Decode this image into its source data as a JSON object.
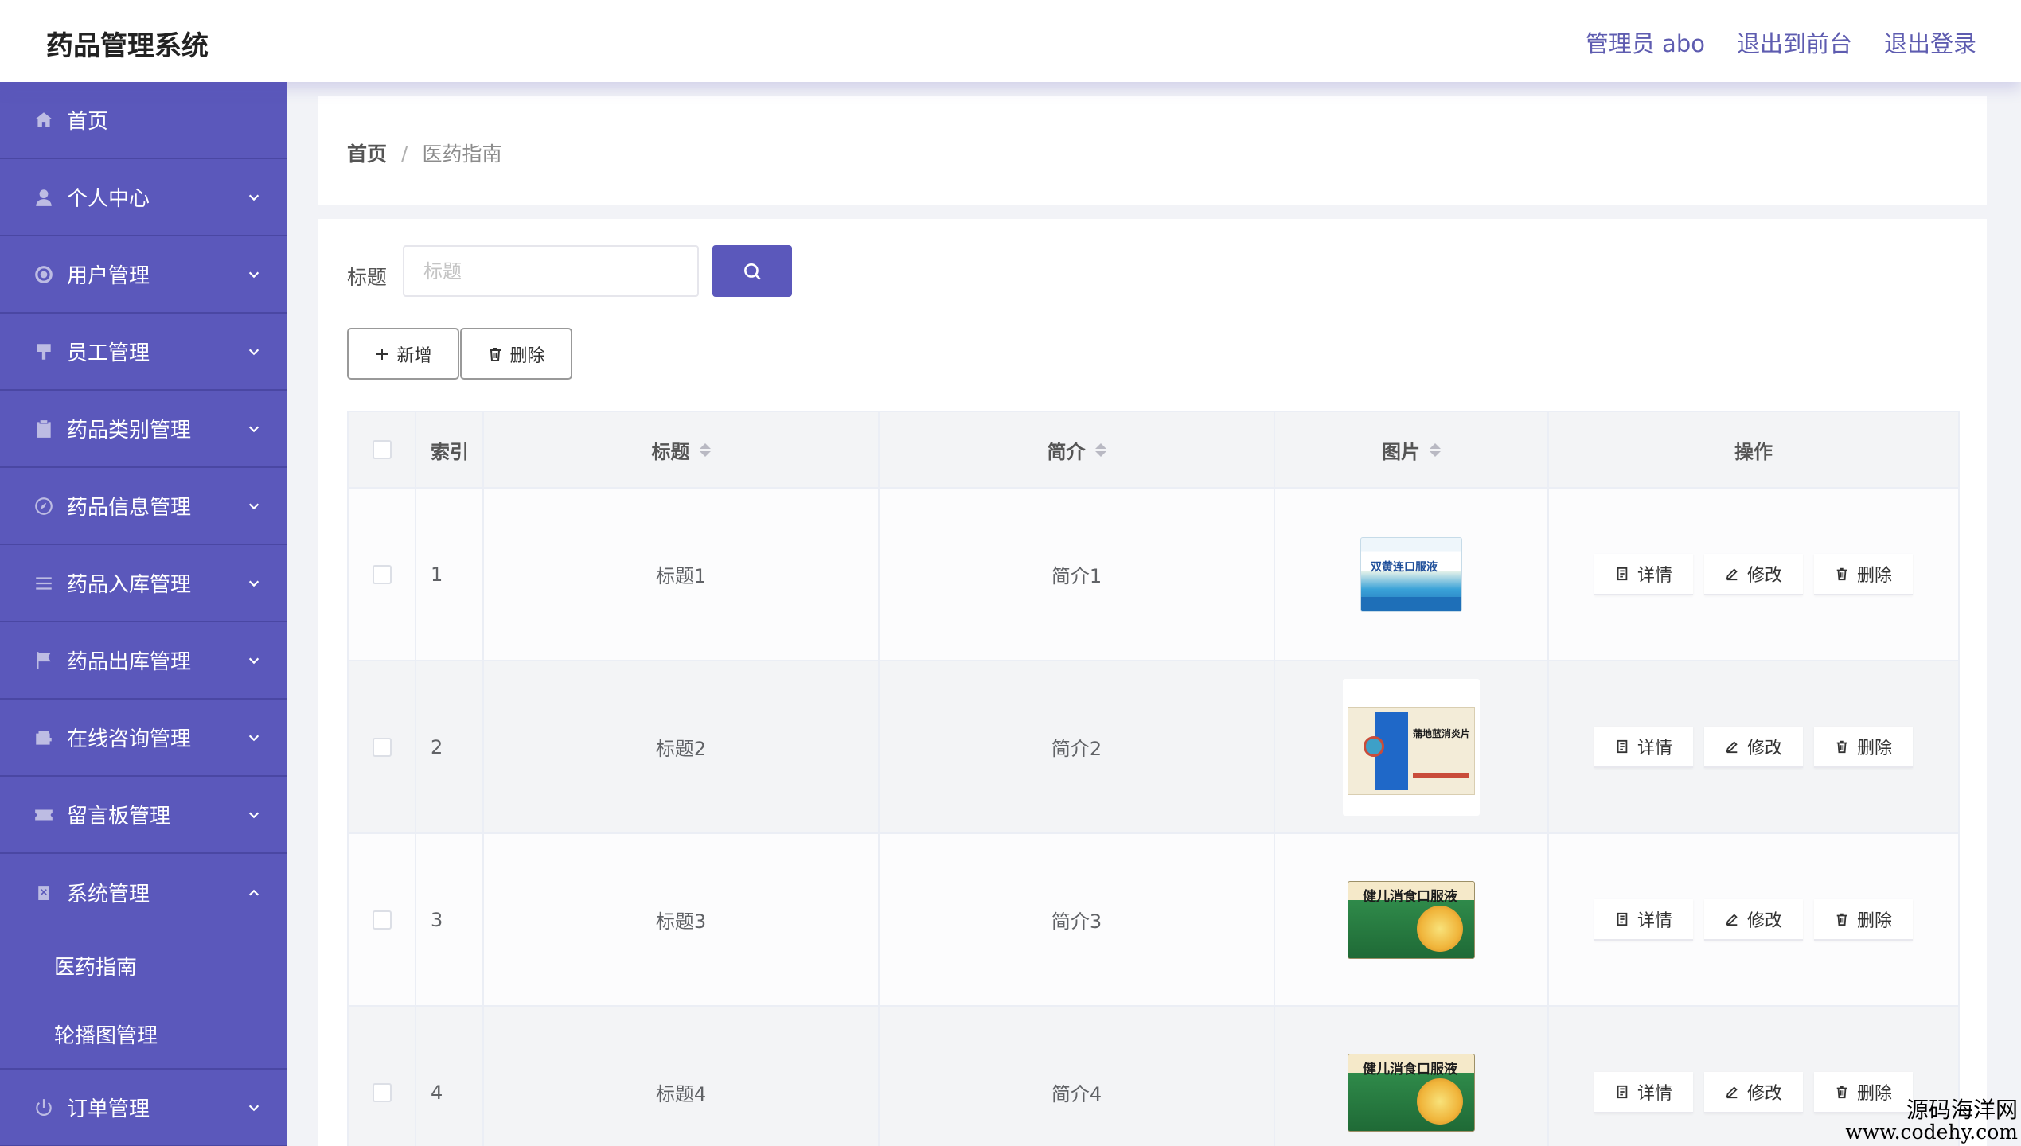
{
  "header": {
    "app_title": "药品管理系统",
    "user": "管理员 abo",
    "to_front": "退出到前台",
    "logout": "退出登录"
  },
  "sidebar": {
    "items": [
      {
        "label": "首页",
        "icon": "home-icon"
      },
      {
        "label": "个人中心",
        "icon": "user-icon"
      },
      {
        "label": "用户管理",
        "icon": "users-icon"
      },
      {
        "label": "员工管理",
        "icon": "staff-icon"
      },
      {
        "label": "药品类别管理",
        "icon": "clipboard-icon"
      },
      {
        "label": "药品信息管理",
        "icon": "compass-icon"
      },
      {
        "label": "药品入库管理",
        "icon": "list-icon"
      },
      {
        "label": "药品出库管理",
        "icon": "flag-icon"
      },
      {
        "label": "在线咨询管理",
        "icon": "wallet-icon"
      },
      {
        "label": "留言板管理",
        "icon": "ticket-icon"
      },
      {
        "label": "系统管理",
        "icon": "system-icon",
        "expanded": true,
        "children": [
          "医药指南",
          "轮播图管理"
        ]
      },
      {
        "label": "订单管理",
        "icon": "power-icon"
      }
    ]
  },
  "breadcrumb": {
    "home": "首页",
    "separator": "/",
    "current": "医药指南"
  },
  "search": {
    "label": "标题",
    "placeholder": "标题"
  },
  "toolbar": {
    "add": "新增",
    "delete": "删除"
  },
  "table": {
    "headers": {
      "index": "索引",
      "title": "标题",
      "desc": "简介",
      "image": "图片",
      "ops": "操作"
    },
    "rows": [
      {
        "index": "1",
        "title": "标题1",
        "desc": "简介1",
        "image_label": "双黄连口服液"
      },
      {
        "index": "2",
        "title": "标题2",
        "desc": "简介2",
        "image_label": "蒲地蓝消炎片"
      },
      {
        "index": "3",
        "title": "标题3",
        "desc": "简介3",
        "image_label": "健儿消食口服液"
      },
      {
        "index": "4",
        "title": "标题4",
        "desc": "简介4",
        "image_label": "健儿消食口服液"
      }
    ],
    "op_labels": {
      "detail": "详情",
      "edit": "修改",
      "delete": "删除"
    }
  },
  "watermark": {
    "line1": "源码海洋网",
    "line2": "www.codehy.com"
  },
  "colors": {
    "accent": "#5b58bb",
    "sidebar_border": "#4a47a3",
    "header_link": "#5e5cb0"
  }
}
